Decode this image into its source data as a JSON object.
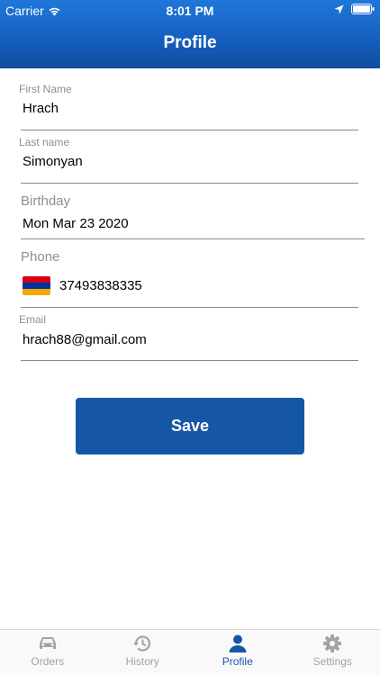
{
  "status_bar": {
    "carrier": "Carrier",
    "time": "8:01 PM"
  },
  "header": {
    "title": "Profile"
  },
  "form": {
    "first_name": {
      "label": "First Name",
      "value": "Hrach"
    },
    "last_name": {
      "label": "Last name",
      "value": "Simonyan"
    },
    "birthday": {
      "label": "Birthday",
      "value": "Mon Mar 23 2020"
    },
    "phone": {
      "label": "Phone",
      "value": "37493838335"
    },
    "email": {
      "label": "Email",
      "value": "hrach88@gmail.com"
    }
  },
  "save_button": {
    "label": "Save"
  },
  "tabbar": {
    "tabs": [
      {
        "label": "Orders",
        "icon": "car-icon"
      },
      {
        "label": "History",
        "icon": "history-icon"
      },
      {
        "label": "Profile",
        "icon": "user-icon"
      },
      {
        "label": "Settings",
        "icon": "gear-icon"
      }
    ],
    "active": "Profile"
  },
  "colors": {
    "accent": "#1657a5",
    "header_top": "#1f77d9",
    "header_bottom": "#0e4c9e",
    "inactive_tab": "#a3a3a3"
  }
}
